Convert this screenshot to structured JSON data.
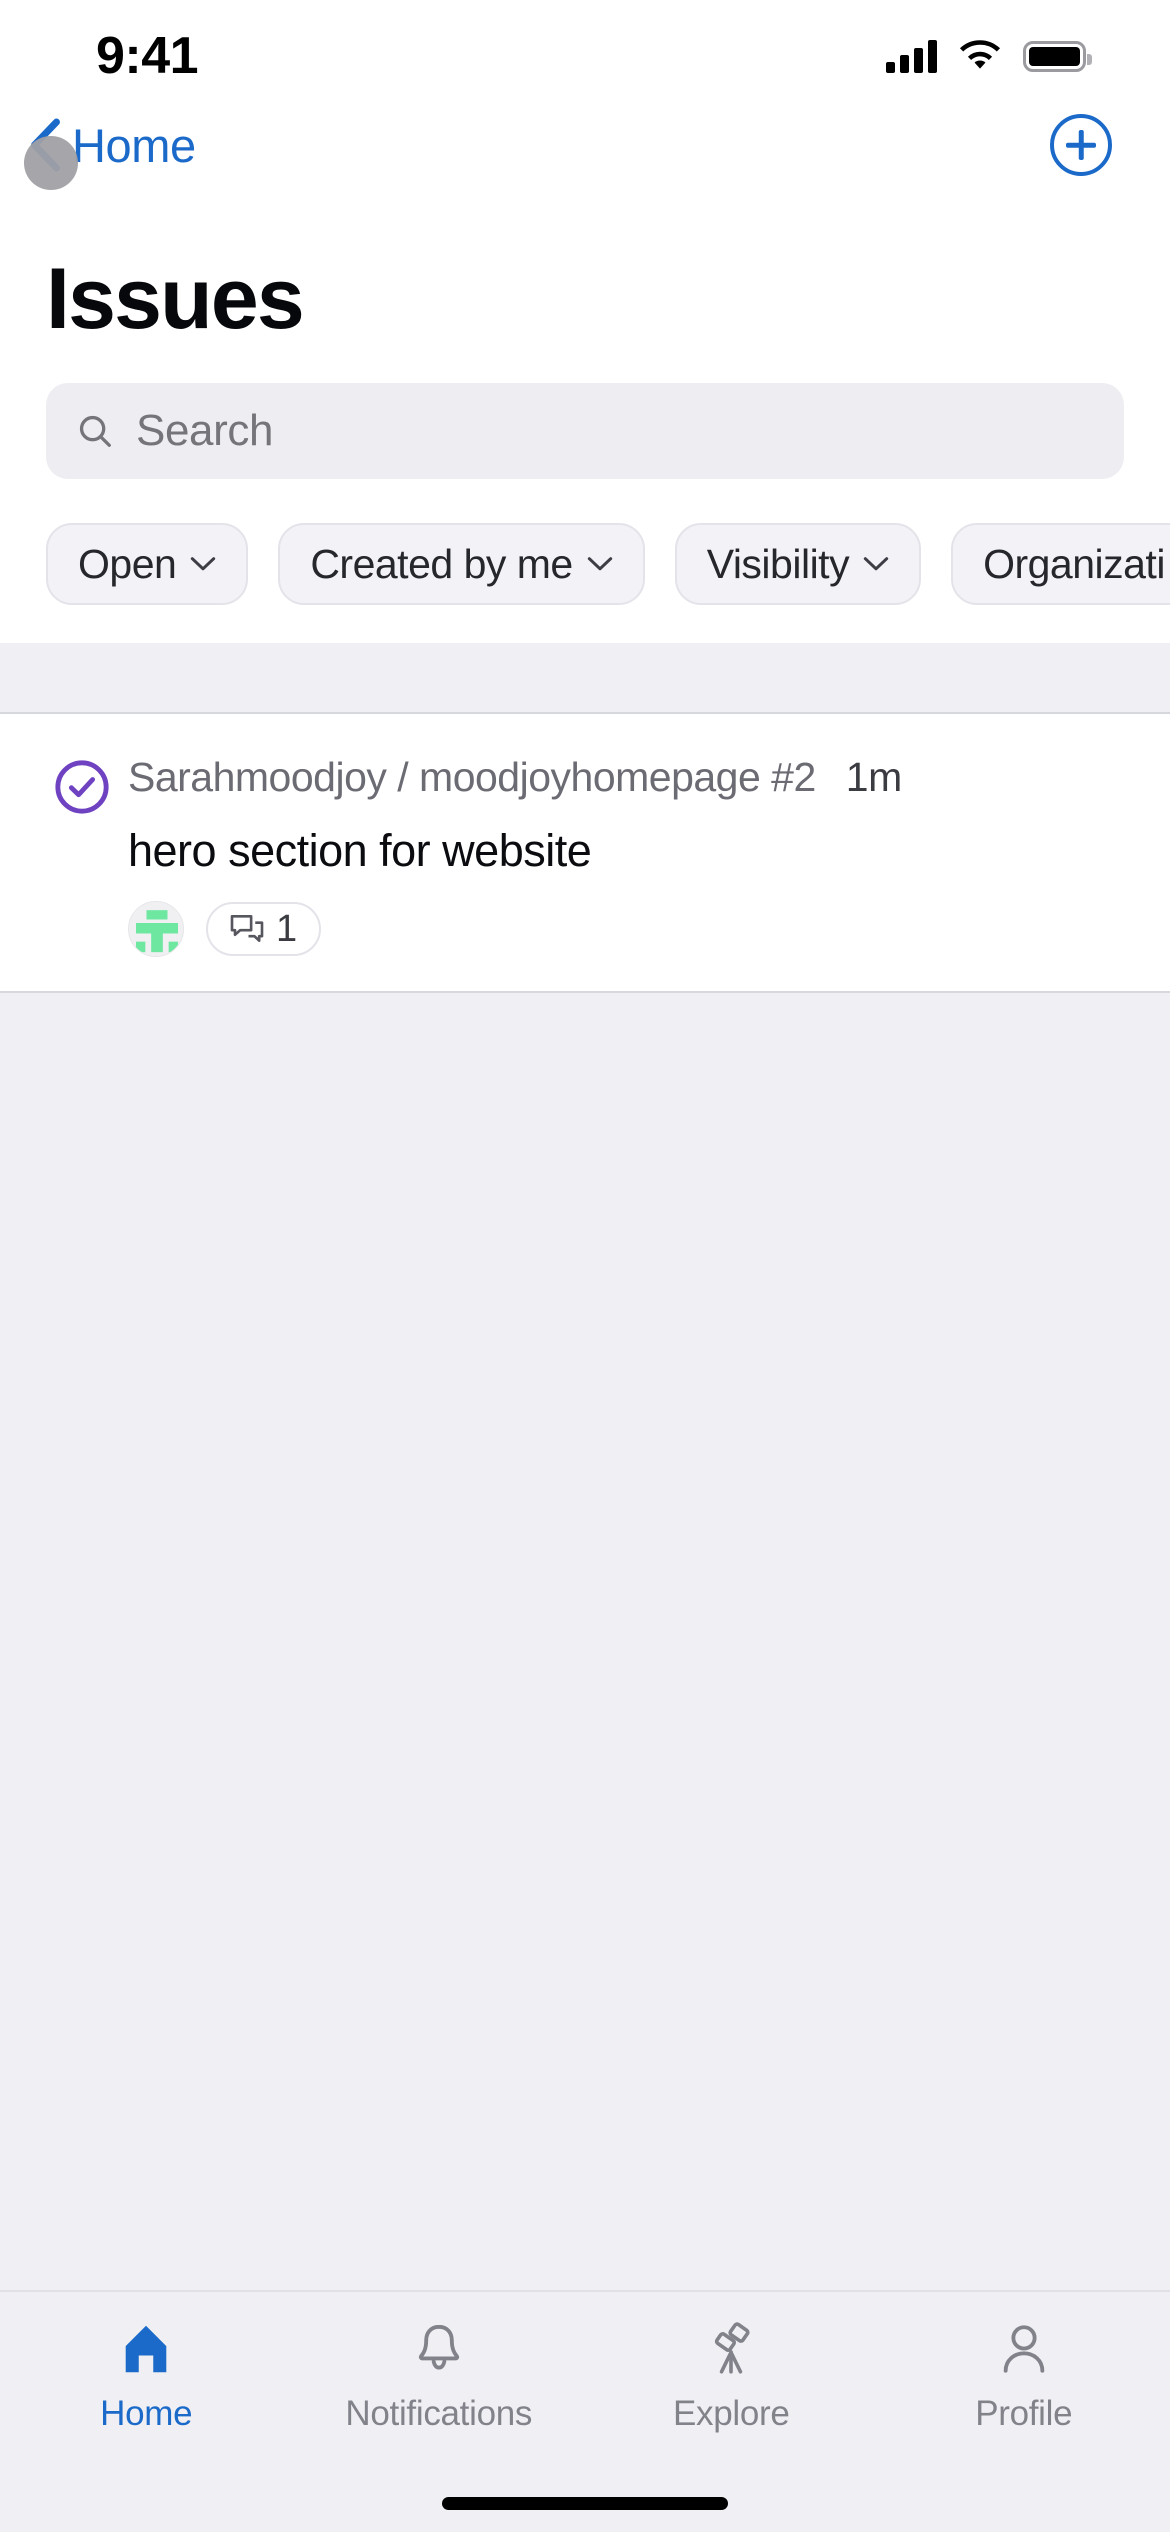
{
  "status_bar": {
    "time": "9:41",
    "signal_icon": "cellular-signal-icon",
    "wifi_icon": "wifi-icon",
    "battery_icon": "battery-full-icon"
  },
  "nav_bar": {
    "back_label": "Home",
    "back_icon": "chevron-left-icon",
    "add_icon": "plus-circle-icon"
  },
  "header": {
    "title": "Issues"
  },
  "search": {
    "placeholder": "Search",
    "value": "",
    "icon": "search-icon"
  },
  "filters": [
    {
      "label": "Open",
      "caret": "chevron-down-icon"
    },
    {
      "label": "Created by me",
      "caret": "chevron-down-icon"
    },
    {
      "label": "Visibility",
      "caret": "chevron-down-icon"
    },
    {
      "label": "Organizati",
      "caret": "chevron-down-icon"
    }
  ],
  "issues": [
    {
      "state_icon": "issue-closed-check-circle-icon",
      "state_color": "#6f42c1",
      "repo": "Sarahmoodjoy / moodjoyhomepage #2",
      "age": "1m",
      "title": "hero section for website",
      "avatar_icon": "user-avatar-identicon",
      "avatar_color": "#6ee7a0",
      "comment_icon": "comment-discussion-icon",
      "comment_count": "1"
    }
  ],
  "tab_bar": {
    "tabs": [
      {
        "label": "Home",
        "icon": "home-icon",
        "active": true
      },
      {
        "label": "Notifications",
        "icon": "bell-icon",
        "active": false
      },
      {
        "label": "Explore",
        "icon": "telescope-icon",
        "active": false
      },
      {
        "label": "Profile",
        "icon": "person-icon",
        "active": false
      }
    ],
    "active_color": "#1b6ac9",
    "inactive_color": "#82828b"
  }
}
